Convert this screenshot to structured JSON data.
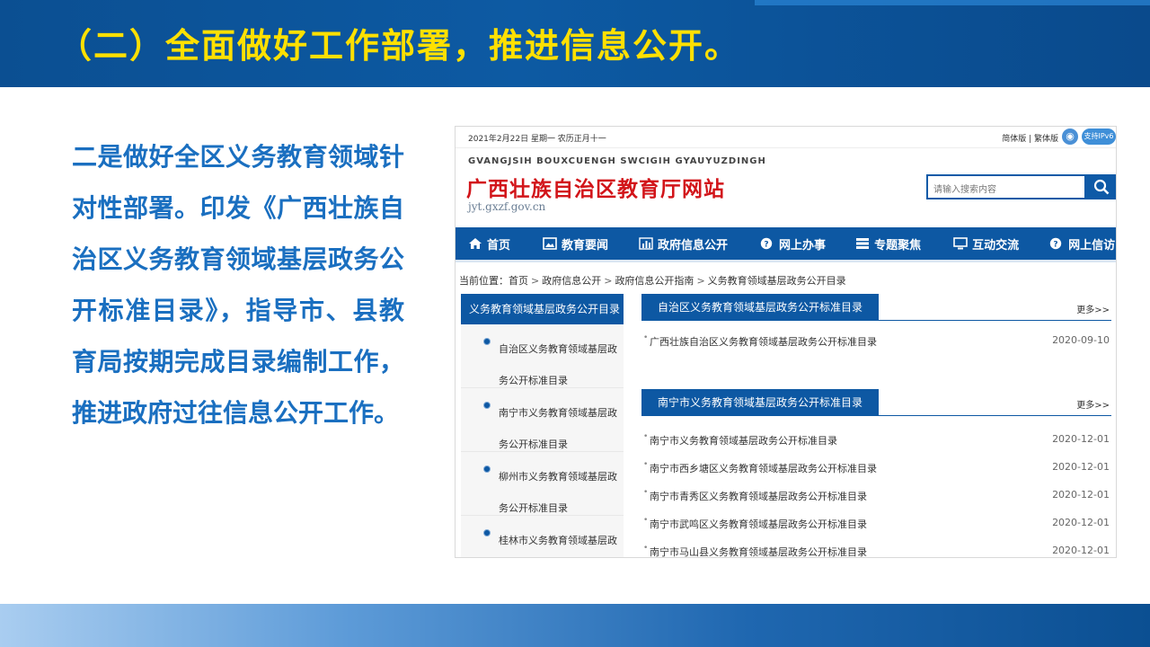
{
  "slide": {
    "title": "（二）全面做好工作部署，推进信息公开。",
    "body": "二是做好全区义务教育领域针对性部署。印发《广西壮族自治区义务教育领域基层政务公开标准目录》，指导市、县教育局按期完成目录编制工作，推进政府过往信息公开工作。",
    "colors": {
      "title": "#ffe000",
      "band": "#0b4f92",
      "body": "#1a6fc0"
    }
  },
  "site": {
    "date": "2021年2月22日 星期一 农历正月十一",
    "lang_simplified": "简体版",
    "lang_traditional": "繁体版",
    "ipv6": "支持IPv6",
    "brand_pinyin": "GVANGJSIH BOUXCUENGH SWCIGIH GYAUYUZDINGH",
    "brand_cn": "广西壮族自治区教育厅网站",
    "brand_url": "jyt.gxzf.gov.cn",
    "search_placeholder": "请输入搜索内容",
    "nav": [
      {
        "label": "首页",
        "icon": "home-icon"
      },
      {
        "label": "教育要闻",
        "icon": "image-icon"
      },
      {
        "label": "政府信息公开",
        "icon": "bar-chart-icon"
      },
      {
        "label": "网上办事",
        "icon": "service-icon"
      },
      {
        "label": "专题聚焦",
        "icon": "list-icon"
      },
      {
        "label": "互动交流",
        "icon": "monitor-icon"
      },
      {
        "label": "网上信访",
        "icon": "chat-icon"
      }
    ],
    "breadcrumb": {
      "prefix": "当前位置：",
      "items": [
        "首页",
        "政府信息公开",
        "政府信息公开指南",
        "义务教育领域基层政务公开目录"
      ]
    },
    "sidebar": {
      "title": "义务教育领域基层政务公开目录",
      "items": [
        "自治区义务教育领域基层政务公开标准目录",
        "南宁市义务教育领域基层政务公开标准目录",
        "柳州市义务教育领域基层政务公开标准目录",
        "桂林市义务教育领域基层政务"
      ]
    },
    "sections": [
      {
        "title": "自治区义务教育领域基层政务公开标准目录",
        "more": "更多>>",
        "rows": [
          {
            "title": "广西壮族自治区义务教育领域基层政务公开标准目录",
            "date": "2020-09-10"
          }
        ]
      },
      {
        "title": "南宁市义务教育领域基层政务公开标准目录",
        "more": "更多>>",
        "rows": [
          {
            "title": "南宁市义务教育领域基层政务公开标准目录",
            "date": "2020-12-01"
          },
          {
            "title": "南宁市西乡塘区义务教育领域基层政务公开标准目录",
            "date": "2020-12-01"
          },
          {
            "title": "南宁市青秀区义务教育领域基层政务公开标准目录",
            "date": "2020-12-01"
          },
          {
            "title": "南宁市武鸣区义务教育领域基层政务公开标准目录",
            "date": "2020-12-01"
          },
          {
            "title": "南宁市马山县义务教育领域基层政务公开标准目录",
            "date": "2020-12-01"
          }
        ]
      }
    ]
  }
}
